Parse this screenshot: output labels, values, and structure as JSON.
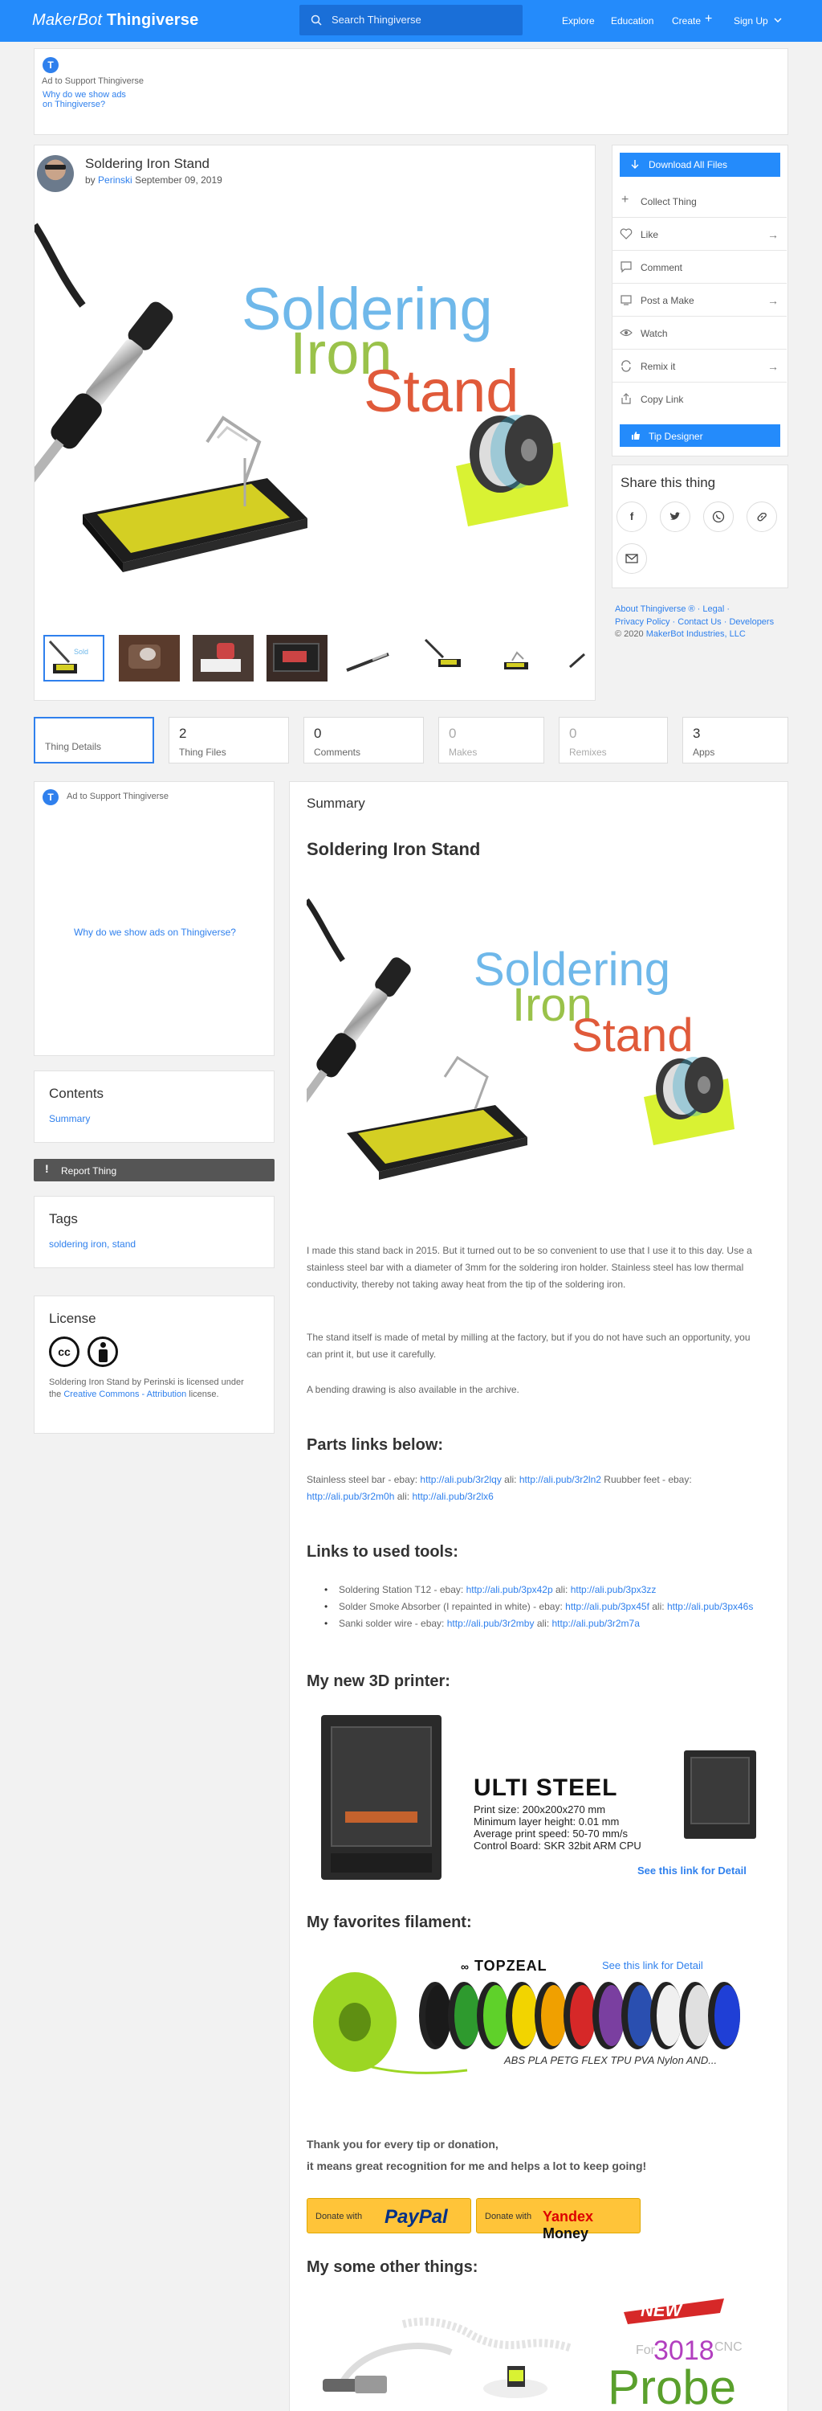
{
  "header": {
    "logo_makerbot": "MakerBot",
    "logo_thingiverse": "Thingiverse",
    "search_placeholder": "Search Thingiverse",
    "nav": [
      "Explore",
      "Education",
      "Create",
      "Sign Up"
    ],
    "brand_color": "#248bfb"
  },
  "top_ad": {
    "badge": "T",
    "label": "Ad to Support Thingiverse",
    "why_line1": "Why do we show ads",
    "why_line2": "on Thingiverse?"
  },
  "thing": {
    "title": "Soldering Iron Stand",
    "by": "by",
    "author": "Perinski",
    "date": "September 09, 2019",
    "hero_words": [
      "Soldering",
      "Iron",
      "Stand"
    ],
    "thumbnail_count": 8
  },
  "actions": {
    "download": "Download All Files",
    "collect": "Collect Thing",
    "like": "Like",
    "comment": "Comment",
    "post_make": "Post a Make",
    "watch": "Watch",
    "remix": "Remix it",
    "copy_link": "Copy Link",
    "tip": "Tip Designer"
  },
  "share": {
    "title": "Share this thing"
  },
  "footer_links": {
    "about": "About Thingiverse ®",
    "legal": "Legal",
    "privacy": "Privacy Policy",
    "contact": "Contact Us",
    "developers": "Developers",
    "copyright": "© 2020",
    "company": "MakerBot Industries, LLC"
  },
  "tabs": [
    {
      "num": "",
      "label": "Thing Details"
    },
    {
      "num": "2",
      "label": "Thing Files"
    },
    {
      "num": "0",
      "label": "Comments"
    },
    {
      "num": "0",
      "label": "Makes"
    },
    {
      "num": "0",
      "label": "Remixes"
    },
    {
      "num": "3",
      "label": "Apps"
    }
  ],
  "left_ad": {
    "label": "Ad to Support Thingiverse",
    "why": "Why do we show ads on Thingiverse?"
  },
  "contents": {
    "title": "Contents",
    "item": "Summary"
  },
  "report": "Report Thing",
  "tags": {
    "title": "Tags",
    "items": "soldering iron, stand"
  },
  "license": {
    "title": "License",
    "text_a": "Soldering Iron Stand by Perinski is licensed under the",
    "link": "Creative Commons - Attribution",
    "text_b": "license."
  },
  "summary": {
    "label": "Summary",
    "title": "Soldering Iron Stand",
    "p1": "I made this stand back in 2015. But it turned out to be so convenient to use that I use it to this day. Use a stainless steel bar with a diameter of 3mm for the soldering iron holder. Stainless steel has low thermal conductivity, thereby not taking away heat from the tip of the soldering iron.",
    "p2": "The stand itself is made of metal by milling at the factory, but if you do not have such an opportunity, you can print it, but use it carefully.",
    "p3": "A bending drawing is also available in the archive.",
    "parts_title": "Parts links below:",
    "parts_a": "Stainless steel bar - ebay:",
    "parts_l1": "http://ali.pub/3r2lqy",
    "parts_b": "ali:",
    "parts_l2": "http://ali.pub/3r2ln2",
    "parts_c": "Ruubber feet - ebay:",
    "parts_l3": "http://ali.pub/3r2m0h",
    "parts_d": "ali:",
    "parts_l4": "http://ali.pub/3r2lx6",
    "tools_title": "Links to used tools:",
    "tools": [
      {
        "text": "Soldering Station T12 - ebay:",
        "l1": "http://ali.pub/3px42p",
        "mid": "ali:",
        "l2": "http://ali.pub/3px3zz"
      },
      {
        "text": "Solder Smoke Absorber (I repainted in white) - ebay:",
        "l1": "http://ali.pub/3px45f",
        "mid": "ali:",
        "l2": "http://ali.pub/3px46s"
      },
      {
        "text": "Sanki solder wire - ebay:",
        "l1": "http://ali.pub/3r2mby",
        "mid": "ali:",
        "l2": "http://ali.pub/3r2m7a"
      }
    ],
    "printer_title": "My new 3D printer:",
    "printer": {
      "name": "ULTI STEEL",
      "spec1": "Print size: 200x200x270 mm",
      "spec2": "Minimum layer height: 0.01 mm",
      "spec3": "Average print speed: 50-70 mm/s",
      "spec4": "Control Board: SKR 32bit ARM CPU",
      "link": "See this link for Detail"
    },
    "filament_title": "My favorites filament:",
    "filament": {
      "brand": "TOPZEAL",
      "link": "See this link for Detail",
      "types": "ABS PLA PETG FLEX TPU PVA Nylon AND...",
      "spool_colors": [
        "#1a1a1a",
        "#2e9a2e",
        "#5fd12a",
        "#f2d400",
        "#f0a000",
        "#d62828",
        "#7a3fa0",
        "#2a4fb0",
        "#f0f0f0",
        "#e0e0e0",
        "#1f3fd6"
      ]
    },
    "thanks1": "Thank you for every tip or donation,",
    "thanks2": "it means great recognition for me and helps a lot to keep going!",
    "donate_with": "Donate with",
    "paypal": "PayPal",
    "yandex": "Yandex",
    "money": "Money",
    "other_title": "My some other things:",
    "probe": {
      "new": "NEW",
      "for": "For",
      "model": "3018",
      "cnc": "CNC",
      "probe": "Probe"
    }
  }
}
